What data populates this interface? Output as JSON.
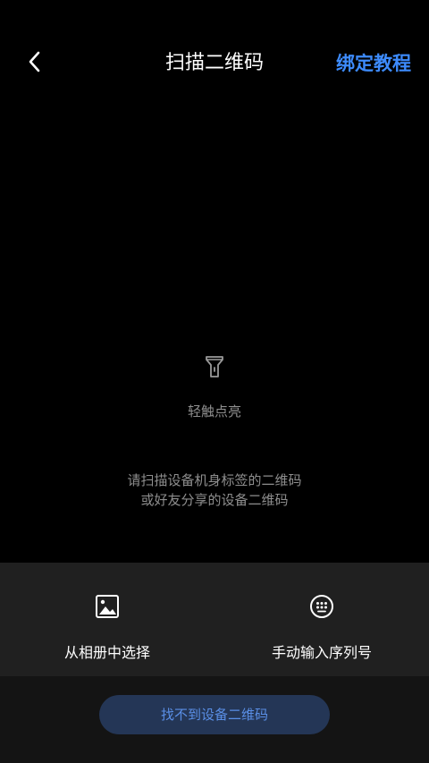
{
  "header": {
    "title": "扫描二维码",
    "tutorial_link": "绑定教程",
    "back_icon": "chevron-left-icon"
  },
  "scan": {
    "flashlight_icon": "flashlight-icon",
    "flashlight_label": "轻触点亮",
    "hint_line1": "请扫描设备机身标签的二维码",
    "hint_line2": "或好友分享的设备二维码"
  },
  "actions": {
    "album": {
      "icon": "image-icon",
      "label": "从相册中选择"
    },
    "manual": {
      "icon": "keypad-icon",
      "label": "手动输入序列号"
    }
  },
  "footer": {
    "cannot_find_label": "找不到设备二维码"
  },
  "colors": {
    "background": "#000000",
    "accent": "#3d8bfd",
    "panel": "#202020",
    "footer": "#141414",
    "button_bg": "#243656",
    "button_text": "#5a8fe6",
    "muted_text": "#8e8e8e"
  }
}
